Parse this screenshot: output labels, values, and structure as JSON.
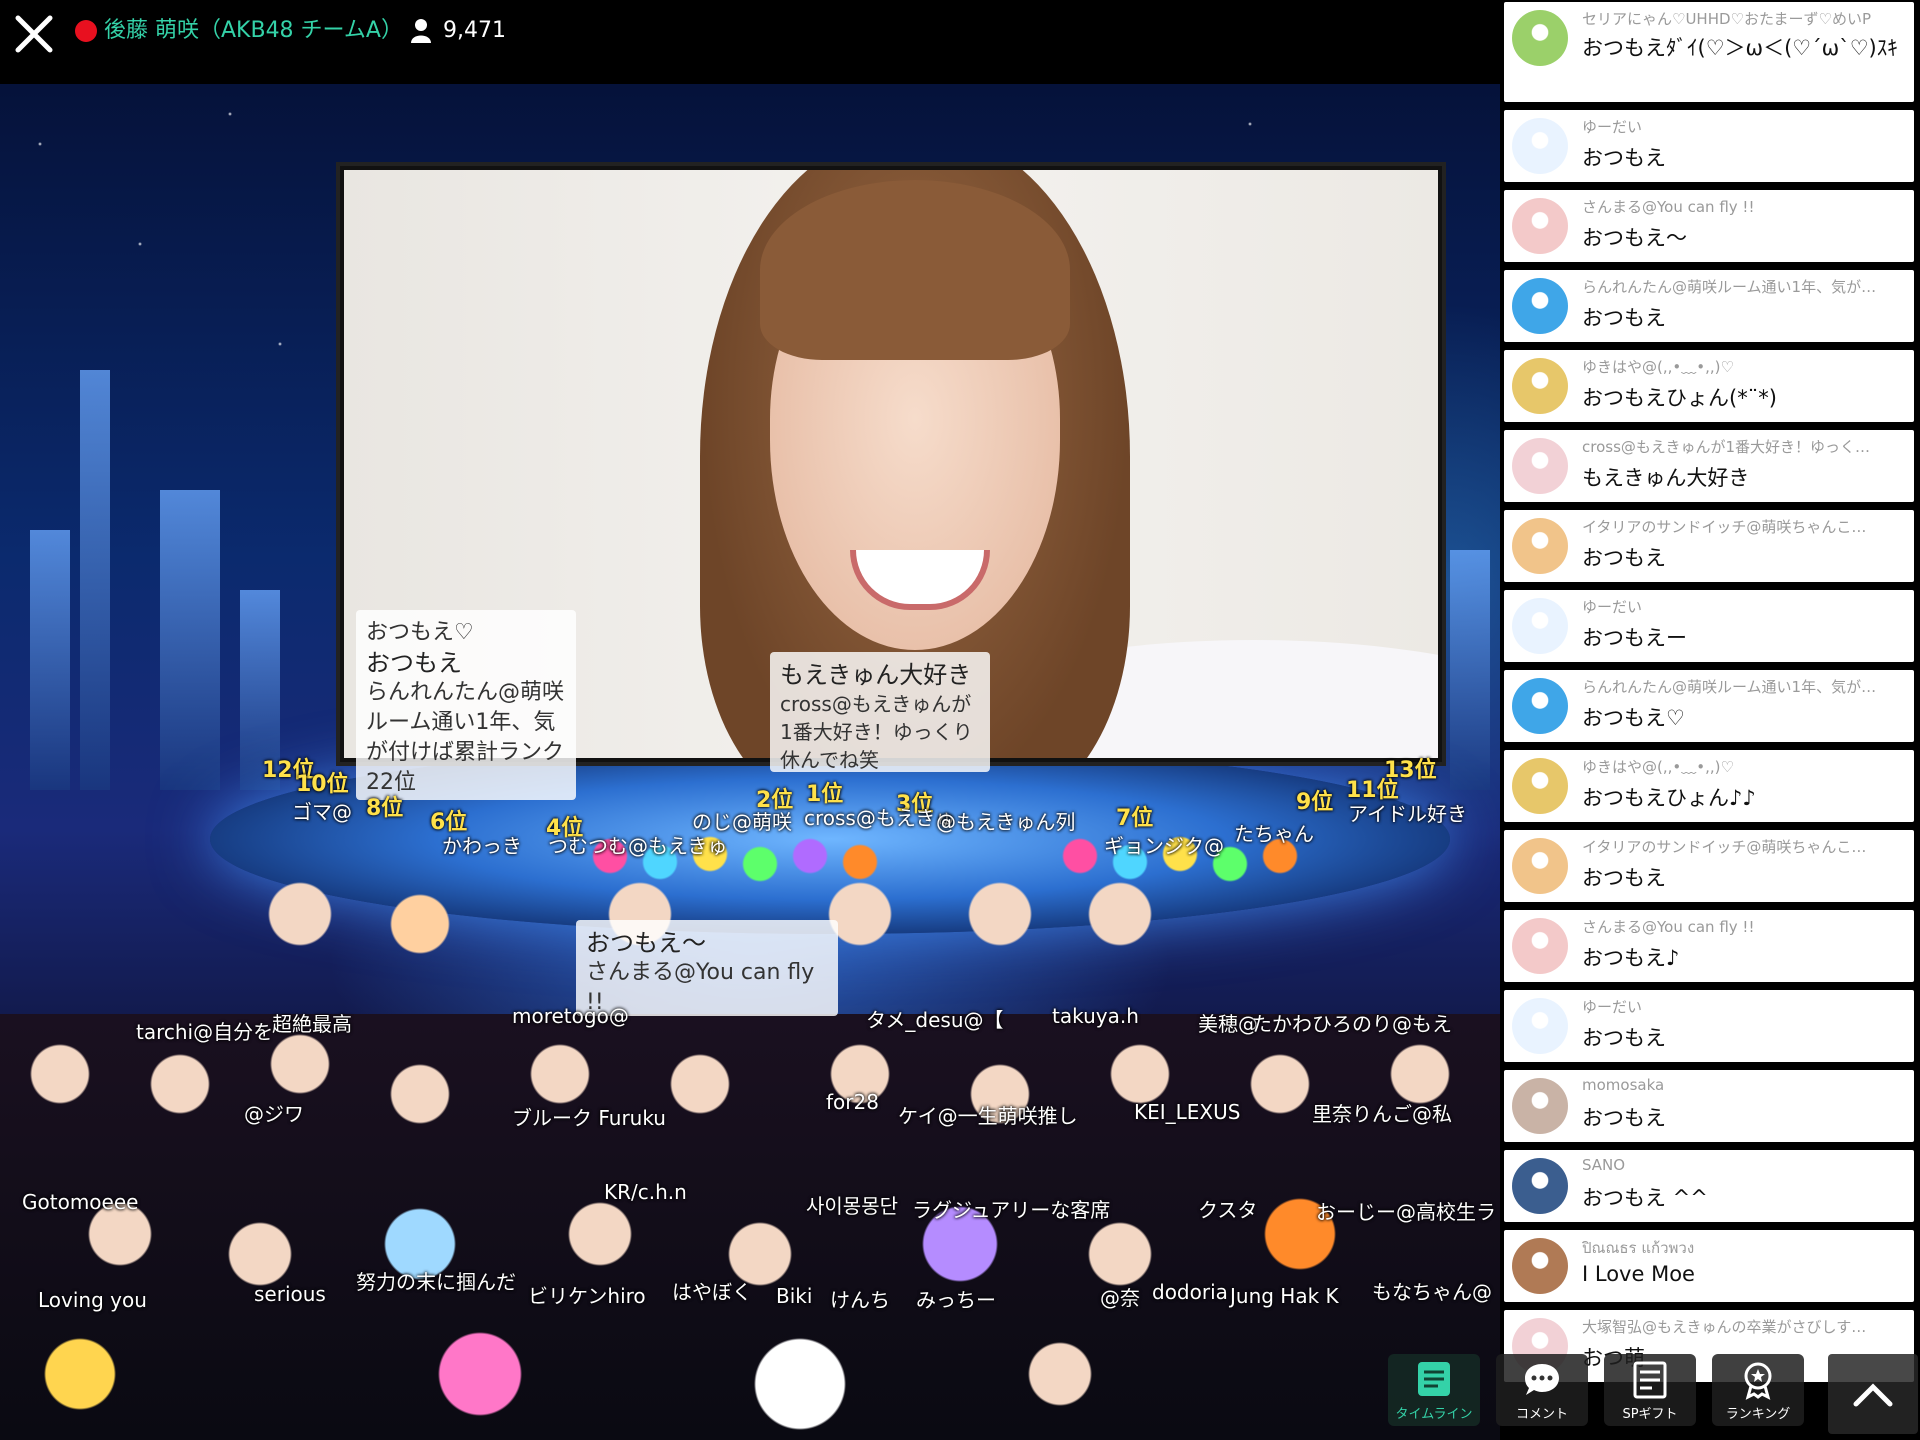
{
  "header": {
    "streamer_name": "後藤 萌咲（AKB48 チームA）",
    "viewer_count": "9,471",
    "live_color": "#e8101f",
    "name_color": "#34d2a8"
  },
  "overlay": {
    "bubble1": [
      "おつもえ♡",
      "おつもえ",
      "らんれんたん@萌咲ルーム通い1年、気が付けば累計ランク22位"
    ],
    "bubble2": [
      "もえきゅん大好き",
      "cross@もえきゅんが1番大好き！ゆっくり休んでね笑"
    ],
    "bubble3": [
      "おつもえ〜",
      "さんまる@You can fly !!"
    ],
    "ranks": [
      {
        "label": "12位"
      },
      {
        "label": "10位"
      },
      {
        "label": "8位"
      },
      {
        "label": "6位"
      },
      {
        "label": "4位"
      },
      {
        "label": "2位"
      },
      {
        "label": "1位"
      },
      {
        "label": "3位"
      },
      {
        "label": "7位"
      },
      {
        "label": "9位"
      },
      {
        "label": "11位"
      },
      {
        "label": "13位"
      }
    ],
    "gift_names": [
      "ゴマ@",
      "かわっき",
      "つむつむ@もえきゅ",
      "のじ@萌咲",
      "cross@もえきゅ",
      "@もえきゅん列",
      "ギョンジク@",
      "たちゃん",
      "アイドル好き",
      "tarchi@自分を",
      "超絶最高",
      "moretogo@",
      "タメ_desu@【",
      "takuya.h",
      "美穂@",
      "たかわひろのり@もえ",
      "@ジワ",
      "ブルーク Furuku",
      "for28",
      "ケイ@一生萌咲推し",
      "KEI_LEXUS",
      "里奈りんご@私",
      "Gotomoeee",
      "KR/c.h.n",
      "사이몽몽단",
      "ラグジュアリーな客席",
      "クスタ",
      "おーじー@高校生ラ",
      "Loving you",
      "serious",
      "努力の末に掴んだ",
      "ビリケンhiro",
      "はやぼく",
      "Biki",
      "けんち",
      "みっちー",
      "@奈",
      "dodoria",
      "Jung Hak K",
      "もなちゃん@"
    ]
  },
  "comments": [
    {
      "user": "セリアにゃん♡UHHD♡おたまーず♡めいP",
      "text": "おつもえﾀﾞｲ(♡＞ω＜(♡´ω`♡)ｽｷ",
      "avatar_color": "#9bd06a"
    },
    {
      "user": "ゆーだい",
      "text": "おつもえ",
      "avatar_color": "#e9f3ff"
    },
    {
      "user": "さんまる@You can fly !!",
      "text": "おつもえ〜",
      "avatar_color": "#f3c9c9"
    },
    {
      "user": "らんれんたん@萌咲ルーム通い1年、気が…",
      "text": "おつもえ",
      "avatar_color": "#3fa6e8"
    },
    {
      "user": "ゆきはや@(,,•﹏•,,)♡",
      "text": "おつもえひょん(*¨*)",
      "avatar_color": "#e7c76a"
    },
    {
      "user": "cross@もえきゅんが1番大好き！ゆっく…",
      "text": "もえきゅん大好き",
      "avatar_color": "#f2d1d6"
    },
    {
      "user": "イタリアのサンドイッチ@萌咲ちゃんこ…",
      "text": "おつもえ",
      "avatar_color": "#f1c48a"
    },
    {
      "user": "ゆーだい",
      "text": "おつもえー",
      "avatar_color": "#e9f3ff"
    },
    {
      "user": "らんれんたん@萌咲ルーム通い1年、気が…",
      "text": "おつもえ♡",
      "avatar_color": "#3fa6e8"
    },
    {
      "user": "ゆきはや@(,,•﹏•,,)♡",
      "text": "おつもえひょん♪♪",
      "avatar_color": "#e7c76a"
    },
    {
      "user": "イタリアのサンドイッチ@萌咲ちゃんこ…",
      "text": "おつもえ",
      "avatar_color": "#f1c48a"
    },
    {
      "user": "さんまる@You can fly !!",
      "text": "おつもえ♪",
      "avatar_color": "#f3c9c9"
    },
    {
      "user": "ゆーだい",
      "text": "おつもえ",
      "avatar_color": "#e9f3ff"
    },
    {
      "user": "momosaka",
      "text": "おつもえ",
      "avatar_color": "#c9b3a6"
    },
    {
      "user": "SANO",
      "text": "おつもえ ^^",
      "avatar_color": "#3b5e8f"
    },
    {
      "user": "ปิณณธร แก้วพวง",
      "text": "I Love Moe",
      "avatar_color": "#b07a55"
    },
    {
      "user": "大塚智弘@もえきゅんの卒業がさびしす…",
      "text": "おつ萌",
      "avatar_color": "#f2d1d6"
    }
  ],
  "nav": {
    "timeline": "タイムライン",
    "comment": "コメント",
    "sp_gift": "SPギフト",
    "ranking": "ランキング",
    "active_color": "#34d2a8"
  }
}
